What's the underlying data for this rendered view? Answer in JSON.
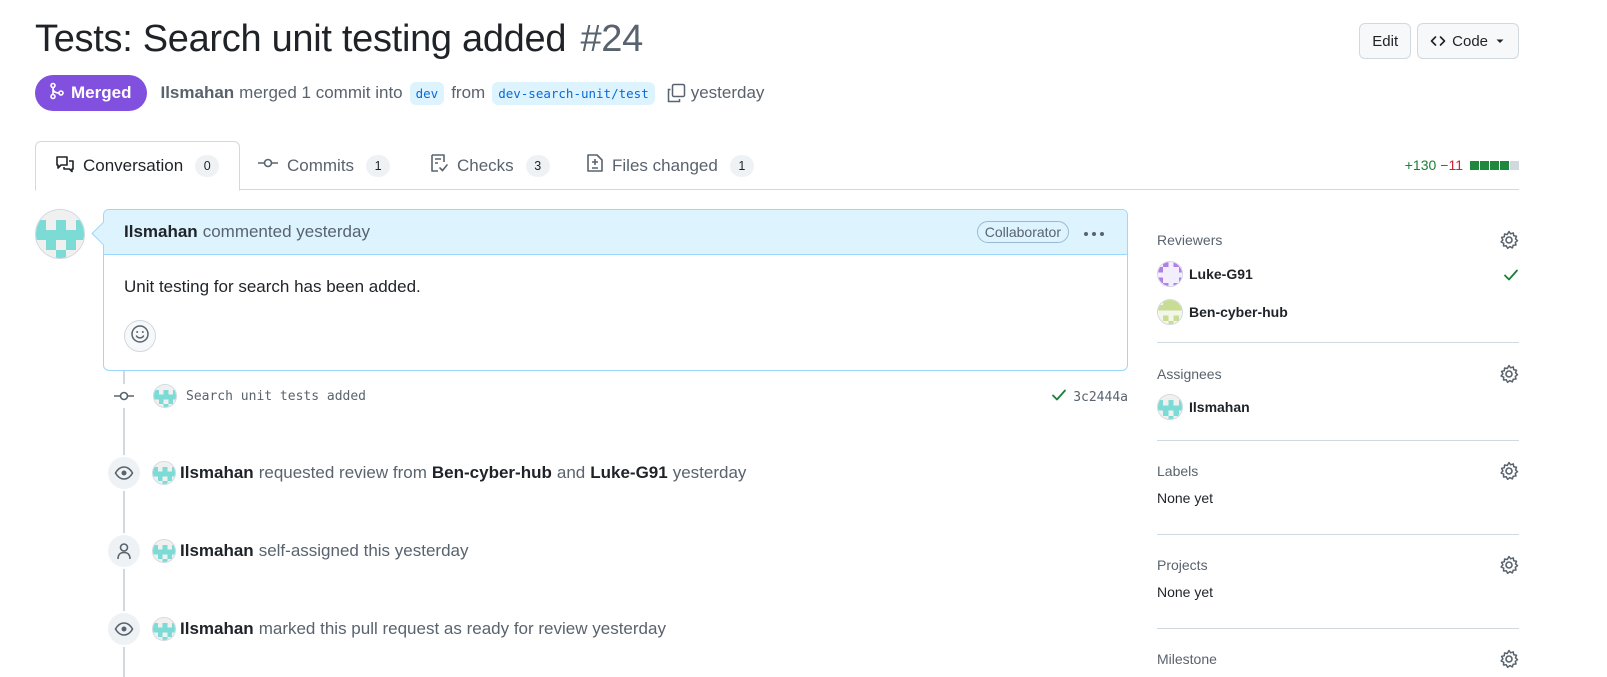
{
  "header": {
    "title": "Tests: Search unit testing added",
    "number": "#24",
    "edit_label": "Edit",
    "code_label": "Code"
  },
  "meta": {
    "state": "Merged",
    "author": "Ilsmahan",
    "merged_text": "merged 1 commit into",
    "base_branch": "dev",
    "from_text": "from",
    "head_branch": "dev-search-unit/test",
    "time": "yesterday"
  },
  "tabs": [
    {
      "label": "Conversation",
      "count": "0"
    },
    {
      "label": "Commits",
      "count": "1"
    },
    {
      "label": "Checks",
      "count": "3"
    },
    {
      "label": "Files changed",
      "count": "1"
    }
  ],
  "diffstat": {
    "additions": "+130",
    "deletions": "−11"
  },
  "comment": {
    "author": "Ilsmahan",
    "action": "commented yesterday",
    "role": "Collaborator",
    "body": "Unit testing for search has been added."
  },
  "commit": {
    "message": "Search unit tests added",
    "sha": "3c2444a"
  },
  "events": [
    {
      "actor": "Ilsmahan",
      "text1": "requested review from",
      "target1": "Ben-cyber-hub",
      "text2": "and",
      "target2": "Luke-G91",
      "time": "yesterday"
    },
    {
      "actor": "Ilsmahan",
      "text": "self-assigned this yesterday"
    },
    {
      "actor": "Ilsmahan",
      "text": "marked this pull request as ready for review yesterday"
    }
  ],
  "sidebar": {
    "reviewers_title": "Reviewers",
    "reviewers": [
      {
        "name": "Luke-G91",
        "status": "approved"
      },
      {
        "name": "Ben-cyber-hub",
        "status": "pending"
      }
    ],
    "assignees_title": "Assignees",
    "assignees": [
      "Ilsmahan"
    ],
    "labels_title": "Labels",
    "labels_value": "None yet",
    "projects_title": "Projects",
    "projects_value": "None yet",
    "milestone_title": "Milestone"
  },
  "colors": {
    "merged": "#8250df",
    "accent_blue": "#0969da",
    "success": "#1a7f37",
    "danger": "#d1242f",
    "pending": "#9a6700"
  }
}
